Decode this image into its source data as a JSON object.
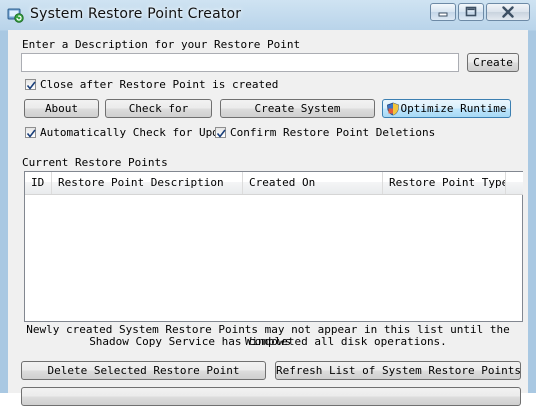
{
  "window": {
    "title": "System Restore Point Creator"
  },
  "icons": {
    "app": "restore-app-icon",
    "minimize": "minimize-icon",
    "maximize": "maximize-icon",
    "close": "close-icon",
    "optimize": "shield-icon"
  },
  "description": {
    "label": "Enter a Description for your Restore Point",
    "value": "",
    "create_label": "Create"
  },
  "options": {
    "close_after_label": "Close after Restore Point is created",
    "close_after_checked": true,
    "auto_check_label": "Automatically Check for Updat",
    "auto_check_checked": true,
    "confirm_delete_label": "Confirm Restore Point Deletions",
    "confirm_delete_checked": true
  },
  "toolbar": {
    "about_label": "About",
    "check_label": "Check for",
    "create_system_label": "Create System",
    "optimize_label": "Optimize Runtime"
  },
  "list": {
    "title": "Current Restore Points",
    "columns": [
      "ID",
      "Restore Point Description",
      "Created On",
      "Restore Point Type"
    ],
    "rows": []
  },
  "notice": {
    "line1": "Newly created System Restore Points may not appear in this list until the Windows",
    "line2": "Shadow Copy Service has completed all disk operations."
  },
  "actions": {
    "delete_label": "Delete Selected Restore Point",
    "refresh_label": "Refresh List of System Restore Points"
  },
  "colors": {
    "frame": "#a9c8e2",
    "client": "#f0f0f0",
    "highlight": "#bee6fd"
  }
}
